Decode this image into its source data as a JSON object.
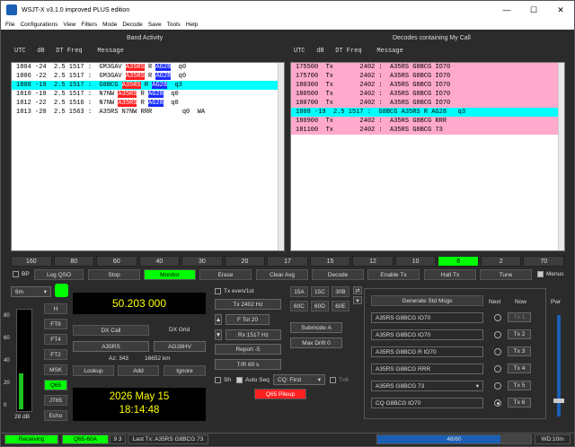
{
  "window": {
    "title": "WSJT-X   v3.1.0  improved PLUS edition",
    "minimize": "—",
    "maximize": "☐",
    "close": "✕"
  },
  "menu": [
    "File",
    "Configurations",
    "View",
    "Filters",
    "Mode",
    "Decode",
    "Save",
    "Tools",
    "Help"
  ],
  "band_activity": {
    "title": "Band Activity",
    "header": "UTC   dB   DT Freq    Message",
    "lines": [
      {
        "pre": "1804 -24  2.5 1517 :  GM3GAV ",
        "call": "A35RS",
        "mid": " R ",
        "grid": "AG28",
        "post": "  q0",
        "hl": ""
      },
      {
        "pre": "1806 -22  2.5 1517 :  GM3GAV ",
        "call": "A35RS",
        "mid": " R ",
        "grid": "AG28",
        "post": "  q0",
        "hl": ""
      },
      {
        "pre": "1808 -19  2.5 1517 :  G8BCG ",
        "call": "A35RS",
        "mid": " R ",
        "grid": "AG28",
        "post": "  q3",
        "hl": "cyan"
      },
      {
        "pre": "1810 -19  2.5 1517 :  N7NW ",
        "call": "A35RS",
        "mid": " R ",
        "grid": "AG28",
        "post": "  q0",
        "hl": ""
      },
      {
        "pre": "1812 -22  2.5 1516 :  N7NW ",
        "call": "A35RS",
        "mid": " R ",
        "grid": "AG28",
        "post": "  q0",
        "hl": ""
      },
      {
        "pre": "1813 -20  2.5 1563 :  A35RS N7NW RRR        q0  WA",
        "call": "",
        "mid": "",
        "grid": "",
        "post": "",
        "hl": ""
      }
    ]
  },
  "my_call": {
    "title": "Decodes containing My Call",
    "header": "UTC   dB   DT Freq    Message",
    "lines": [
      {
        "text": "175500  Tx       2402 :  A35RS G8BCG IO70",
        "hl": "pink"
      },
      {
        "text": "175700  Tx       2402 :  A35RS G8BCG IO70",
        "hl": "pink"
      },
      {
        "text": "180300  Tx       2402 :  A35RS G8BCG IO70",
        "hl": "pink"
      },
      {
        "text": "180500  Tx       2402 :  A35RS G8BCG IO70",
        "hl": "pink"
      },
      {
        "text": "180700  Tx       2402 :  A35RS G8BCG IO70",
        "hl": "pink"
      },
      {
        "text": "1808 -19  2.5 1517 :  G8BCG A35RS R AG28   q3",
        "hl": "cyan"
      },
      {
        "text": "180900  Tx       2402 :  A35RS G8BCG RRR",
        "hl": "pink"
      },
      {
        "text": "181100  Tx       2402 :  A35RS G8BCG 73",
        "hl": "pink"
      }
    ]
  },
  "bands": [
    "160",
    "80",
    "60",
    "40",
    "30",
    "20",
    "17",
    "15",
    "12",
    "10",
    "6",
    "2",
    "70"
  ],
  "selected_band": "6",
  "controls": {
    "bp": "BP",
    "log_qso": "Log QSO",
    "stop": "Stop",
    "monitor": "Monitor",
    "erase": "Erase",
    "clear_avg": "Clear Avg",
    "decode": "Decode",
    "enable_tx": "Enable Tx",
    "halt_tx": "Halt Tx",
    "tune": "Tune",
    "menus": "Menus"
  },
  "band_select": "6m",
  "frequency": "50.203 000",
  "meter_ticks": [
    "80",
    "60",
    "40",
    "20",
    "0"
  ],
  "meter_level": "28 dB",
  "modes": [
    "H",
    "FT8",
    "FT4",
    "FT2",
    "MSK",
    "Q65",
    "JT65",
    "Echo"
  ],
  "selected_mode": "Q65",
  "dx": {
    "call_label": "DX Call",
    "grid_label": "DX Grid",
    "call": "A35RS",
    "grid": "AG28HV",
    "az": "Az: 343",
    "dist": "16652 km",
    "lookup": "Lookup",
    "add": "Add",
    "ignore": "Ignore"
  },
  "clock": {
    "date": "2026 May 15",
    "time": "18:14:48"
  },
  "tx_panel": {
    "tx_even": "Tx even/1st",
    "tx_hz": "Tx  2402  Hz",
    "ftol": "F Tol  20",
    "rx_hz": "Rx  1517  Hz",
    "report": "Report  -5",
    "tr": "T/R  60  s",
    "sh": "Sh",
    "auto_seq": "Auto Seq",
    "cq": "CQ: First",
    "tx6": "Tx6",
    "pileup": "Q65 Pileup"
  },
  "submodes": [
    "15A",
    "15C",
    "30B",
    "60C",
    "60D",
    "60E"
  ],
  "submode_box": "Submode  A",
  "max_drift": "Max Drift  0",
  "messages": {
    "gen_btn": "Generate Std Msgs",
    "next": "Next",
    "now": "Now",
    "pwr": "Pwr",
    "items": [
      {
        "text": "A35RS G8BCG IO70",
        "tx": "Tx 1",
        "dim": true
      },
      {
        "text": "A35RS G8BCG IO70",
        "tx": "Tx 2",
        "dim": false
      },
      {
        "text": "A35RS G8BCG R IO70",
        "tx": "Tx 3",
        "dim": false
      },
      {
        "text": "A35RS G8BCG RRR",
        "tx": "Tx 4",
        "dim": false
      },
      {
        "text": "A35RS G8BCG 73",
        "tx": "Tx 5",
        "dim": false
      },
      {
        "text": "CQ G8BCG IO70",
        "tx": "Tx 6",
        "dim": false
      }
    ]
  },
  "status": {
    "state": "Receiving",
    "mode": "Q65-60A",
    "nums": "9  3",
    "last_tx": "Last Tx: A35RS G8BCG 73",
    "progress": "48/60",
    "progress_value": 0.8,
    "wd": "WD:10m"
  },
  "colors": {
    "accent_green": "#00ff00",
    "call_red": "#ff2020",
    "grid_blue": "#1a2bff",
    "cyan": "#00ffff",
    "pink": "#ffaacc"
  }
}
